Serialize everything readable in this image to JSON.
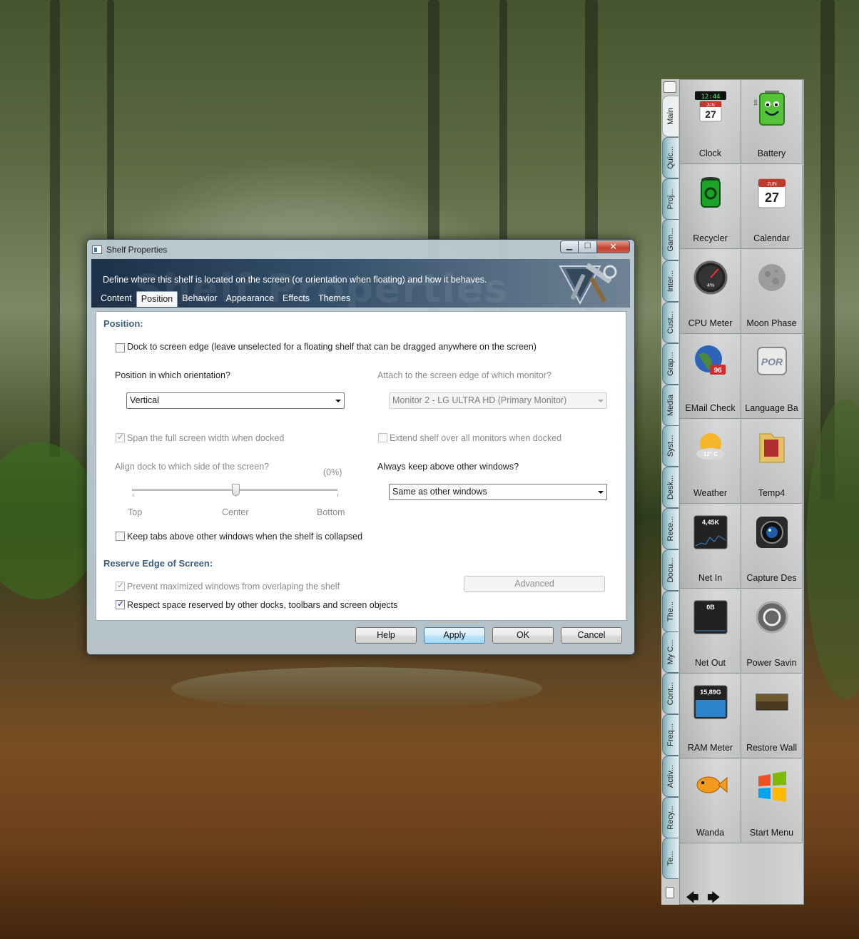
{
  "dialog": {
    "title": "Shelf Properties",
    "caption_buttons": {
      "minimize": "▁",
      "maximize": "☐",
      "close": "✕"
    },
    "header_watermark": "Shelf Properties",
    "description": "Define where this shelf is located on the screen (or orientation when floating) and how it behaves.",
    "tabs": [
      "Content",
      "Position",
      "Behavior",
      "Appearance",
      "Effects",
      "Themes"
    ],
    "active_tab": "Position",
    "position": {
      "section_title": "Position:",
      "dock_to_edge": {
        "label": "Dock to screen edge (leave unselected for a floating shelf that can be dragged anywhere on the screen)",
        "checked": false
      },
      "orientation_label": "Position in which orientation?",
      "orientation_value": "Vertical",
      "monitor_label": "Attach to the screen edge of which monitor?",
      "monitor_value": "Monitor 2 - LG ULTRA HD (Primary Monitor)",
      "span_full_width": {
        "label": "Span the full screen width when docked",
        "checked": true,
        "disabled": true
      },
      "extend_all_monitors": {
        "label": "Extend shelf over all monitors when docked",
        "checked": false,
        "disabled": true
      },
      "align_label": "Align dock to which side of the screen?",
      "align_percent": "(0%)",
      "align_value": 0.5,
      "align_ticks": {
        "top": "Top",
        "center": "Center",
        "bottom": "Bottom"
      },
      "keep_above_label": "Always keep above other windows?",
      "keep_above_value": "Same as other windows",
      "keep_tabs_above": {
        "label": "Keep tabs above other windows when the shelf is collapsed",
        "checked": false
      }
    },
    "reserve": {
      "section_title": "Reserve Edge of Screen:",
      "prevent_maximized": {
        "label": "Prevent maximized windows from overlaping the shelf",
        "checked": true,
        "disabled": true
      },
      "respect_space": {
        "label": "Respect space reserved by other docks, toolbars and screen objects",
        "checked": true
      },
      "advanced_button": "Advanced"
    },
    "buttons": {
      "help": "Help",
      "apply": "Apply",
      "ok": "OK",
      "cancel": "Cancel"
    }
  },
  "shelf": {
    "tabs": [
      "Main",
      "Quic...",
      "Proj...",
      "Gam...",
      "Inter...",
      "Cust...",
      "Grap...",
      "Media",
      "Syst...",
      "Desk...",
      "Rece...",
      "Docu...",
      "The...",
      "My C...",
      "Cont...",
      "Freq...",
      "Activ...",
      "Recy...",
      "Te..."
    ],
    "active_tab": "Main",
    "items": [
      {
        "name": "Clock",
        "icon": "clock-icon"
      },
      {
        "name": "Battery",
        "icon": "battery-icon"
      },
      {
        "name": "Recycler",
        "icon": "recycler-icon"
      },
      {
        "name": "Calendar",
        "icon": "calendar-icon"
      },
      {
        "name": "CPU Meter",
        "icon": "cpu-meter-icon"
      },
      {
        "name": "Moon Phase",
        "icon": "moon-phase-icon"
      },
      {
        "name": "EMail Check",
        "icon": "email-check-icon"
      },
      {
        "name": "Language Ba",
        "icon": "language-bar-icon"
      },
      {
        "name": "Weather",
        "icon": "weather-icon"
      },
      {
        "name": "Temp4",
        "icon": "folder-icon"
      },
      {
        "name": "Net In",
        "icon": "net-in-icon"
      },
      {
        "name": "Capture Des",
        "icon": "camera-icon"
      },
      {
        "name": "Net Out",
        "icon": "net-out-icon"
      },
      {
        "name": "Power Savin",
        "icon": "power-saving-icon"
      },
      {
        "name": "RAM Meter",
        "icon": "ram-meter-icon"
      },
      {
        "name": "Restore Wall",
        "icon": "restore-wallpaper-icon"
      },
      {
        "name": "Wanda",
        "icon": "fish-icon"
      },
      {
        "name": "Start Menu",
        "icon": "windows-logo-icon"
      }
    ],
    "icon_text": {
      "clock_digits": "12:44",
      "clock_month": "JUN",
      "clock_day": "27",
      "calendar_month": "JUN",
      "calendar_day": "27",
      "cpu_percent": "4%",
      "email_count": "96",
      "language_code": "POR",
      "weather_temp": "12° C",
      "battery_level": "100",
      "net_in": "4,45K",
      "net_out": "0B",
      "ram": "15,89G"
    },
    "nav": {
      "back": "🡄",
      "forward": "🡆"
    }
  }
}
